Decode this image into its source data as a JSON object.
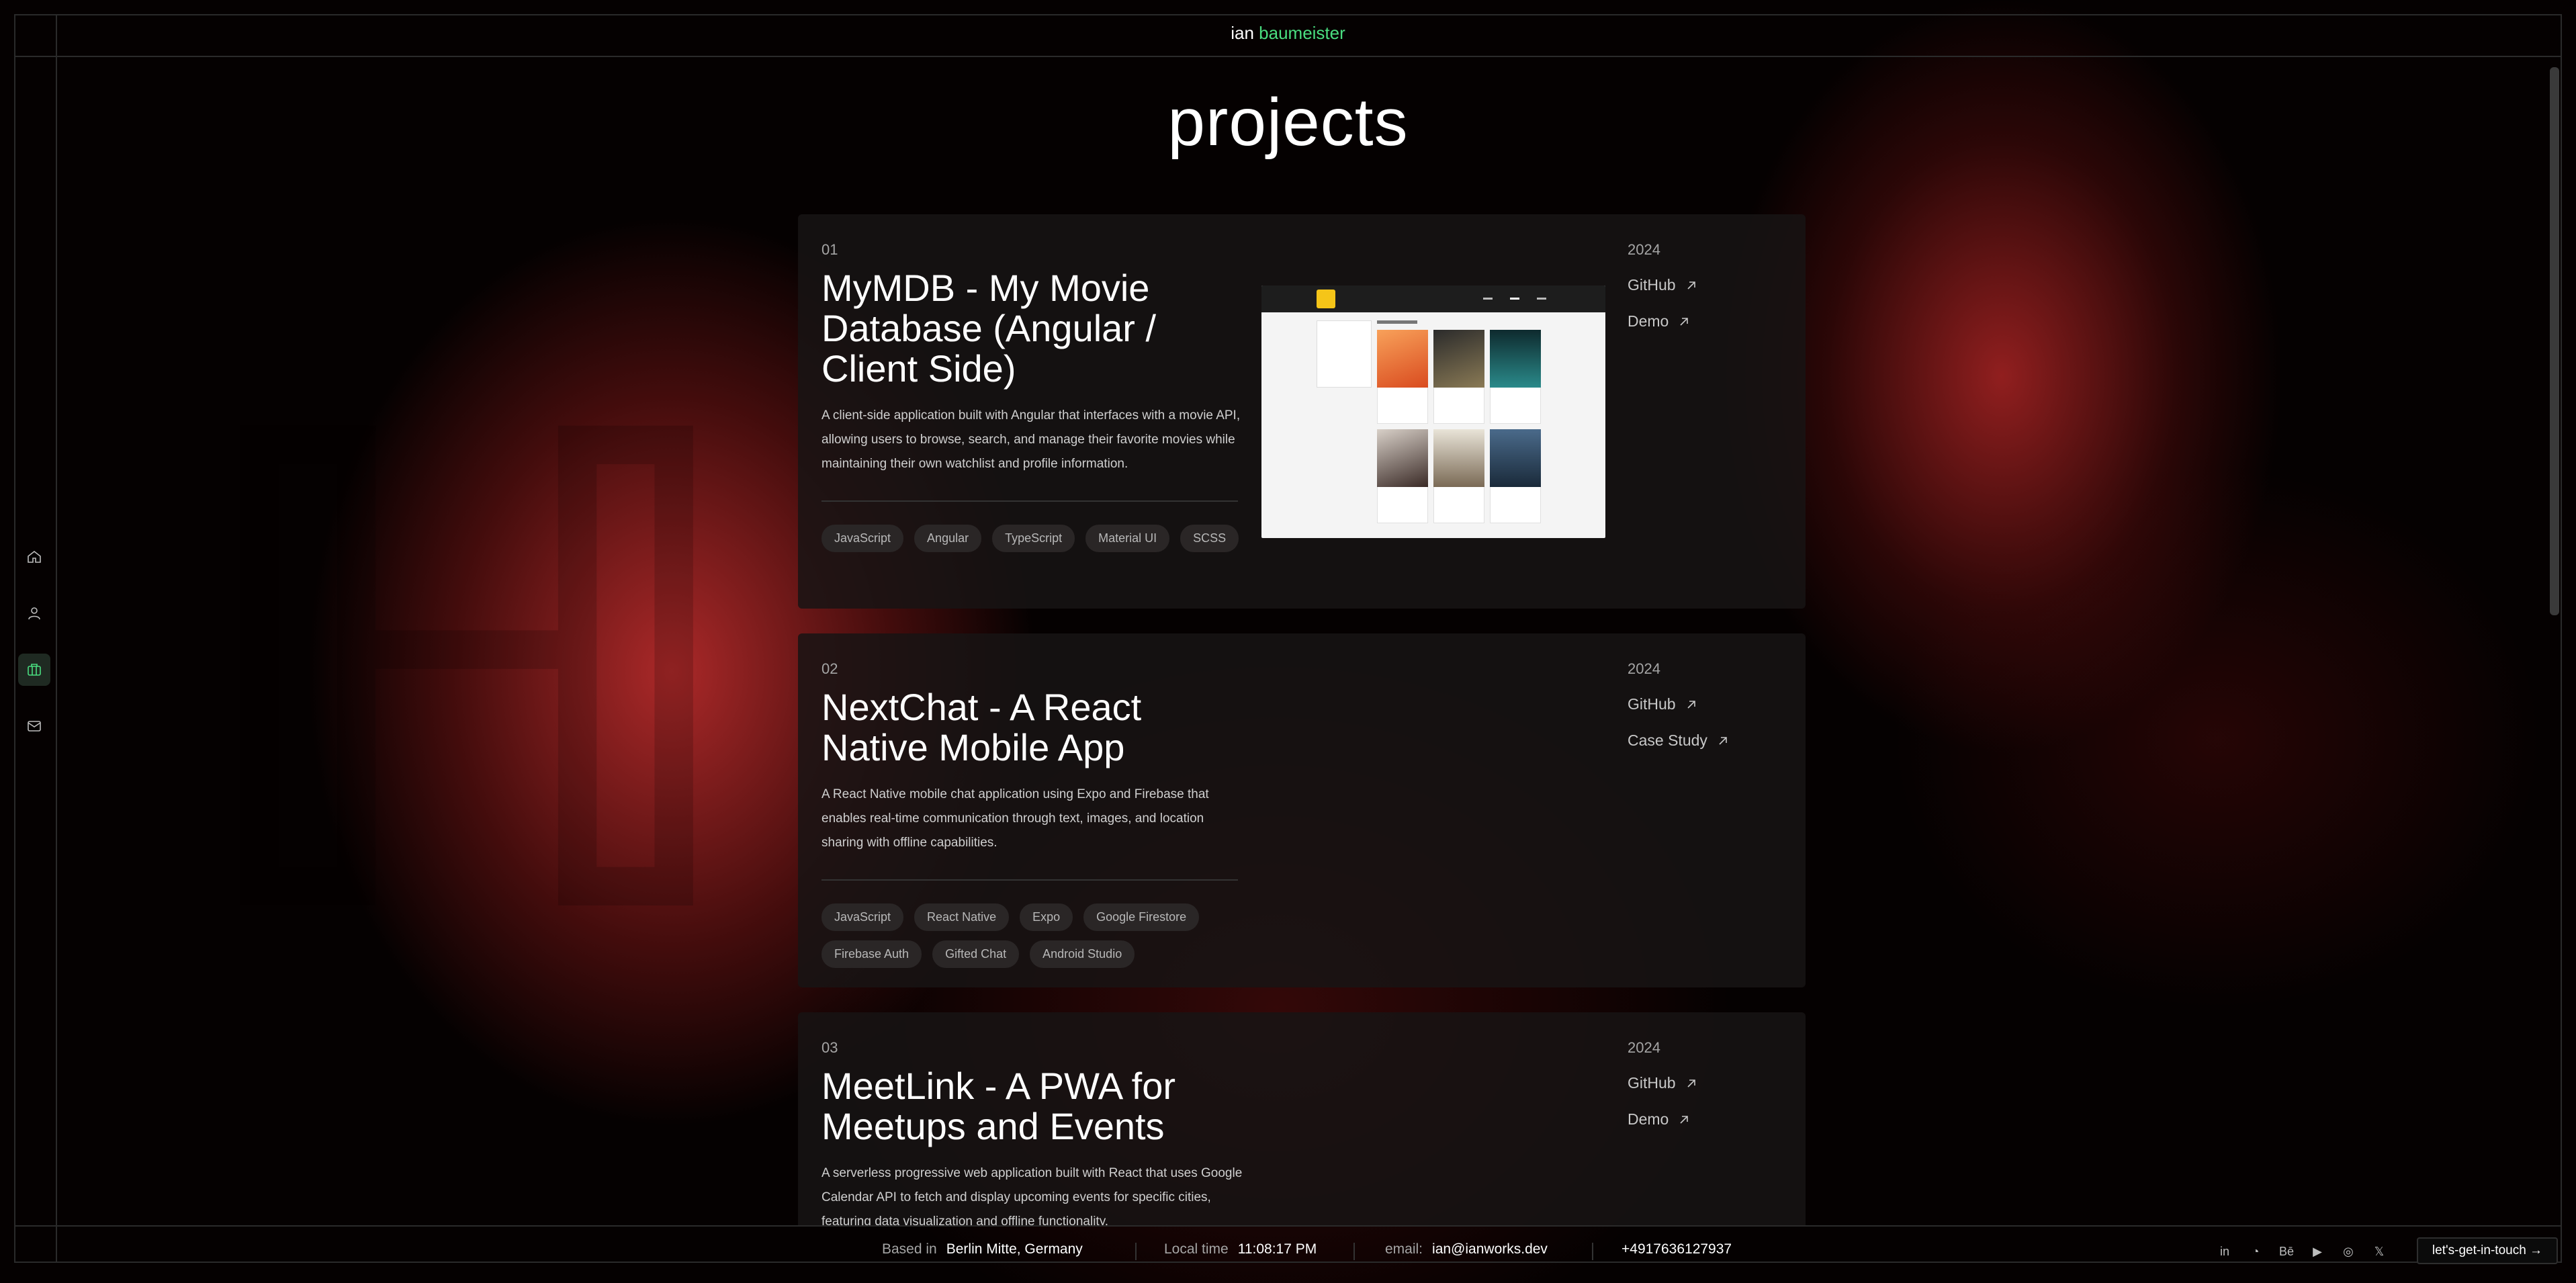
{
  "brand": {
    "first": "ian",
    "last": "baumeister"
  },
  "page": {
    "title": "projects"
  },
  "sidenav": {
    "items": [
      {
        "name": "home",
        "icon": "home-icon"
      },
      {
        "name": "about",
        "icon": "user-icon"
      },
      {
        "name": "projects",
        "icon": "briefcase-icon",
        "active": true
      },
      {
        "name": "contact",
        "icon": "mail-icon"
      }
    ]
  },
  "projects": [
    {
      "number": "01",
      "title": "MyMDB - My Movie Database (Angular / Client Side)",
      "description": "A client-side application built with Angular that interfaces with a movie API, allowing users to browse, search, and manage their favorite movies while maintaining their own watchlist and profile information.",
      "tags": [
        "JavaScript",
        "Angular",
        "TypeScript",
        "Material UI",
        "SCSS"
      ],
      "year": "2024",
      "links": [
        "GitHub",
        "Demo"
      ],
      "screenshot": {
        "heading": "My Favorite Movies"
      }
    },
    {
      "number": "02",
      "title": "NextChat - A React Native Mobile App",
      "description": "A React Native mobile chat application using Expo and Firebase that enables real-time communication through text, images, and location sharing with offline capabilities.",
      "tags": [
        "JavaScript",
        "React Native",
        "Expo",
        "Google Firestore",
        "Firebase Auth",
        "Gifted Chat",
        "Android Studio"
      ],
      "year": "2024",
      "links": [
        "GitHub",
        "Case Study"
      ]
    },
    {
      "number": "03",
      "title": "MeetLink - A PWA for Meetups and Events",
      "description": "A serverless progressive web application built with React that uses Google Calendar API to fetch and display upcoming events for specific cities, featuring data visualization and offline functionality.",
      "year": "2024",
      "links": [
        "GitHub",
        "Demo"
      ]
    }
  ],
  "footer": {
    "based_label": "Based in",
    "based_value": "Berlin Mitte, Germany",
    "time_label": "Local time",
    "time_value": "11:08:17 PM",
    "email_label": "email:",
    "email_value": "ian@ianworks.dev",
    "phone": "+4917636127937",
    "social": [
      {
        "icon": "linkedin-icon",
        "glyph": "in"
      },
      {
        "icon": "github-icon",
        "glyph": "◔"
      },
      {
        "icon": "behance-icon",
        "glyph": "Bē"
      },
      {
        "icon": "youtube-icon",
        "glyph": "▶"
      },
      {
        "icon": "instagram-icon",
        "glyph": "◎"
      },
      {
        "icon": "x-icon",
        "glyph": "𝕏"
      }
    ],
    "cta": "let's-get-in-touch →"
  },
  "colors": {
    "accent": "#4ade80",
    "background": "#000000",
    "glow": "#b92c2c"
  }
}
